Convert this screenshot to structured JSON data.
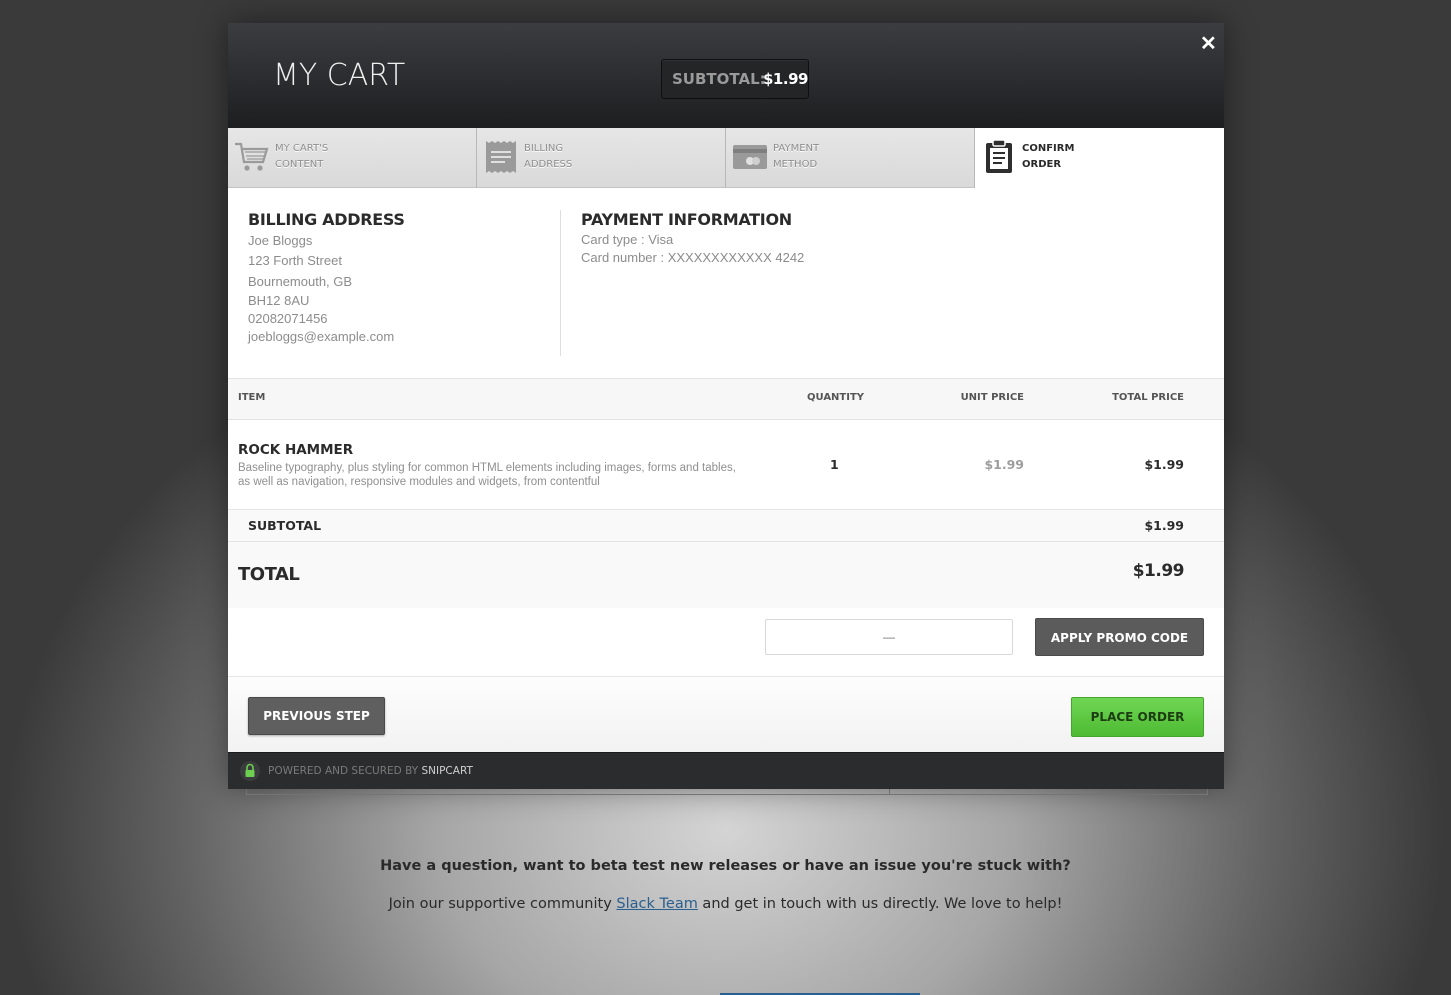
{
  "header": {
    "title": "MY CART",
    "subtotal_label": "SUBTOTAL:",
    "subtotal_value": "$1.99",
    "close_icon": "close-icon"
  },
  "steps": [
    {
      "line1": "MY CART'S",
      "line2": "CONTENT",
      "icon": "cart-icon",
      "active": false
    },
    {
      "line1": "BILLING",
      "line2": "ADDRESS",
      "icon": "receipt-icon",
      "active": false
    },
    {
      "line1": "PAYMENT",
      "line2": "METHOD",
      "icon": "credit-card-icon",
      "active": false
    },
    {
      "line1": "CONFIRM",
      "line2": "ORDER",
      "icon": "clipboard-icon",
      "active": true
    }
  ],
  "billing": {
    "title": "BILLING ADDRESS",
    "name": "Joe Bloggs",
    "street": "123 Forth Street",
    "city": "Bournemouth, GB",
    "postcode": "BH12 8AU",
    "phone": "02082071456",
    "email": "joebloggs@example.com"
  },
  "payment": {
    "title": "PAYMENT INFORMATION",
    "card_type": "Card type : Visa",
    "card_number": "Card number : XXXXXXXXXXXX 4242"
  },
  "table": {
    "headers": {
      "item": "ITEM",
      "quantity": "QUANTITY",
      "unit_price": "UNIT PRICE",
      "total_price": "TOTAL PRICE"
    },
    "items": [
      {
        "name": "ROCK HAMMER",
        "description": "Baseline typography, plus styling for common HTML elements including images, forms and tables, as well as navigation, responsive modules and widgets, from contentful",
        "quantity": "1",
        "unit_price": "$1.99",
        "total_price": "$1.99"
      }
    ],
    "subtotal_label": "SUBTOTAL",
    "subtotal_value": "$1.99",
    "total_label": "TOTAL",
    "total_value": "$1.99"
  },
  "promo": {
    "input_value": "",
    "placeholder": "—",
    "button_label": "APPLY PROMO CODE"
  },
  "nav": {
    "previous_label": "PREVIOUS STEP",
    "place_order_label": "PLACE ORDER"
  },
  "footer": {
    "powered_text": "POWERED AND SECURED BY ",
    "brand": "SNIPCART"
  },
  "page": {
    "question": "Have a question, want to beta test new releases or have an issue you're stuck with?",
    "join_prefix": "Join our supportive community ",
    "join_link": "Slack Team",
    "join_suffix": " and get in touch with us directly. We love to help!"
  },
  "colors": {
    "accent_green": "#5cc842",
    "header_dark": "#1d1e20",
    "link_blue": "#2a5f8f"
  }
}
